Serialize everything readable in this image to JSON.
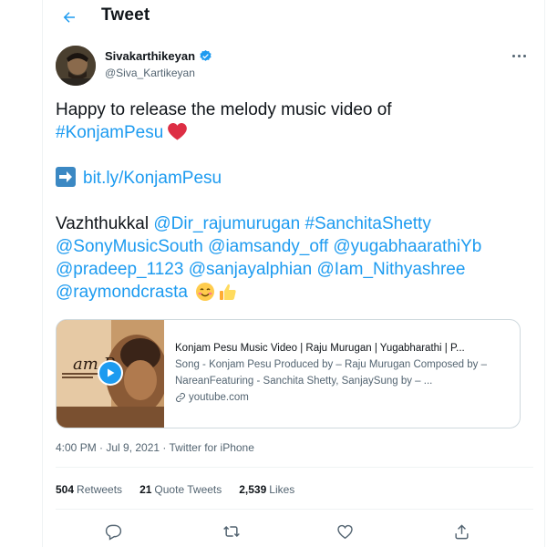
{
  "header": {
    "title": "Tweet",
    "back_icon": "arrow-left-icon"
  },
  "author": {
    "name": "Sivakarthikeyan",
    "handle": "@Siva_Kartikeyan",
    "verified": true
  },
  "tweet": {
    "line1": "Happy to release the melody music video of",
    "hashtag_konjam": "#KonjamPesu",
    "link": "bit.ly/KonjamPesu",
    "vazhthukkal": "Vazhthukkal",
    "mentions": {
      "dir_rajumurugan": "@Dir_rajumurugan",
      "sanchita": "#SanchitaShetty",
      "sonymusicsouth": "@SonyMusicSouth",
      "iamsandy": "@iamsandy_off",
      "yugabhaarathi": "@yugabhaarathiYb",
      "pradeep": "@pradeep_1123",
      "sanjayalphian": "@sanjayalphian",
      "nithyashree": "@Iam_Nithyashree",
      "raymondcrasta": "@raymondcrasta"
    }
  },
  "card": {
    "title": "Konjam Pesu Music Video | Raju Murugan | Yugabharathi | P...",
    "description": "Song - Konjam Pesu Produced by – Raju Murugan Composed by – NareanFeaturing - Sanchita Shetty, SanjaySung by – ...",
    "domain": "youtube.com",
    "thumb_text": "am P"
  },
  "meta": {
    "time": "4:00 PM · Jul 9, 2021 · ",
    "source": "Twitter for iPhone"
  },
  "stats": {
    "retweets_count": "504",
    "retweets_label": "Retweets",
    "quotes_count": "21",
    "quotes_label": "Quote Tweets",
    "likes_count": "2,539",
    "likes_label": "Likes"
  },
  "colors": {
    "accent": "#1d9bf0",
    "text": "#0f1419",
    "secondary": "#536471",
    "heart": "#dd2e44"
  }
}
